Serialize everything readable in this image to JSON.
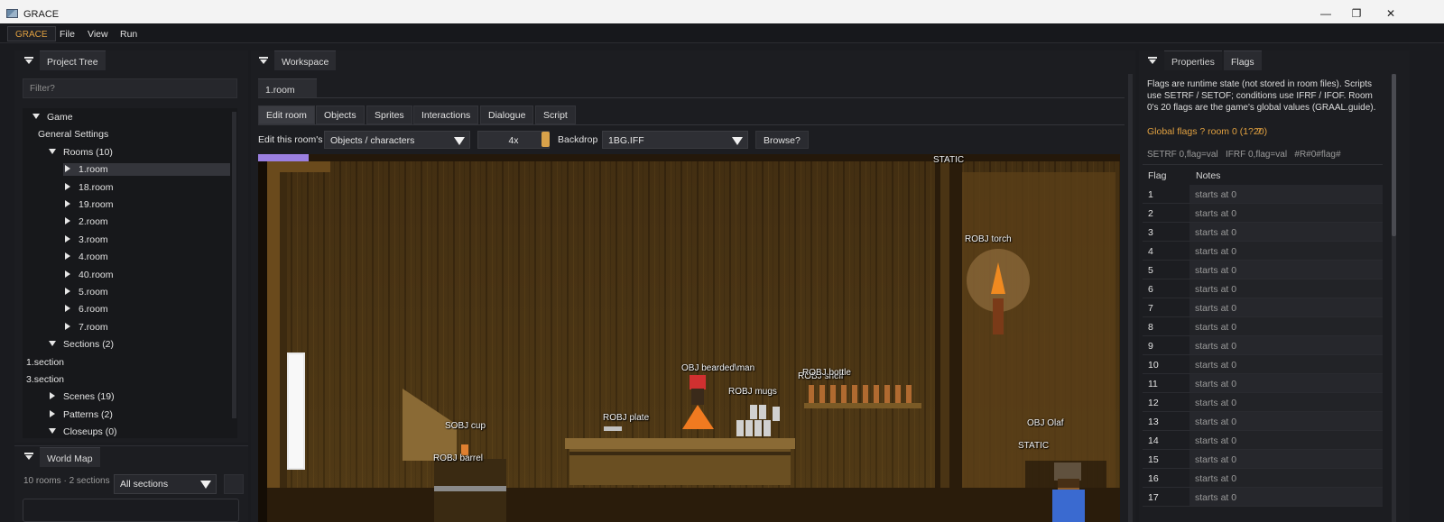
{
  "window": {
    "title": "GRACE",
    "controls": {
      "minimize": "—",
      "maximize": "❐",
      "close": "✕"
    }
  },
  "menubar": {
    "brand": "GRACE",
    "items": [
      "File",
      "View",
      "Run"
    ]
  },
  "left_panel": {
    "tab": "Project Tree",
    "filter_placeholder": "Filter?",
    "tree": [
      {
        "label": "Game",
        "level": 0,
        "state": "expanded"
      },
      {
        "label": "General Settings",
        "level": 1,
        "state": "leaf"
      },
      {
        "label": "Rooms (10)",
        "level": 1,
        "state": "expanded"
      },
      {
        "label": "1.room",
        "level": 2,
        "state": "collapsed",
        "selected": true
      },
      {
        "label": "18.room",
        "level": 2,
        "state": "collapsed"
      },
      {
        "label": "19.room",
        "level": 2,
        "state": "collapsed"
      },
      {
        "label": "2.room",
        "level": 2,
        "state": "collapsed"
      },
      {
        "label": "3.room",
        "level": 2,
        "state": "collapsed"
      },
      {
        "label": "4.room",
        "level": 2,
        "state": "collapsed"
      },
      {
        "label": "40.room",
        "level": 2,
        "state": "collapsed"
      },
      {
        "label": "5.room",
        "level": 2,
        "state": "collapsed"
      },
      {
        "label": "6.room",
        "level": 2,
        "state": "collapsed"
      },
      {
        "label": "7.room",
        "level": 2,
        "state": "collapsed"
      },
      {
        "label": "Sections (2)",
        "level": 1,
        "state": "expanded"
      },
      {
        "label": "1.section",
        "level": 1,
        "state": "leaf"
      },
      {
        "label": "3.section",
        "level": 1,
        "state": "leaf"
      },
      {
        "label": "Scenes (19)",
        "level": 1,
        "state": "collapsed"
      },
      {
        "label": "Patterns (2)",
        "level": 1,
        "state": "collapsed"
      },
      {
        "label": "Closeups (0)",
        "level": 1,
        "state": "expanded"
      }
    ]
  },
  "world_map": {
    "tab": "World Map",
    "summary": "10 rooms · 2 sections",
    "section_select": "All sections"
  },
  "workspace": {
    "tab": "Workspace",
    "doc_tab": "1.room",
    "mode_tabs": [
      "Edit room",
      "Objects",
      "Sprites",
      "Interactions",
      "Dialogue",
      "Script"
    ],
    "active_mode": "Edit room",
    "edit_label": "Edit this room's",
    "edit_select": "Objects / characters",
    "zoom": "4x",
    "backdrop_label": "Backdrop",
    "backdrop_value": "1BG.IFF",
    "browse_label": "Browse?",
    "object_tags": [
      "STATIC",
      "ROBJ torch",
      "OBJ bearded\\man",
      "ROBJ mugs",
      "ROBJ shelf",
      "ROBJ bottle",
      "ROBJ plate",
      "SOBJ cup",
      "ROBJ barrel",
      "OBJ Olaf",
      "STATIC"
    ]
  },
  "right_panel": {
    "tabs": [
      "Properties",
      "Flags"
    ],
    "active_tab": "Flags",
    "description": "Flags are runtime state (not stored in room files). Scripts use SETRF / SETOF; conditions use IFRF / IFOF. Room 0's 20 flags are the game's global values (GRAAL.guide).",
    "global_heading": "Global flags ? room 0 (1?20)",
    "help_mark": "?",
    "syntax": "SETRF 0,flag=val   IFRF 0,flag=val   #R#0#flag#",
    "columns": [
      "Flag",
      "Notes"
    ],
    "rows": [
      {
        "flag": "1",
        "note": "starts at 0"
      },
      {
        "flag": "2",
        "note": "starts at 0"
      },
      {
        "flag": "3",
        "note": "starts at 0"
      },
      {
        "flag": "4",
        "note": "starts at 0"
      },
      {
        "flag": "5",
        "note": "starts at 0"
      },
      {
        "flag": "6",
        "note": "starts at 0"
      },
      {
        "flag": "7",
        "note": "starts at 0"
      },
      {
        "flag": "8",
        "note": "starts at 0"
      },
      {
        "flag": "9",
        "note": "starts at 0"
      },
      {
        "flag": "10",
        "note": "starts at 0"
      },
      {
        "flag": "11",
        "note": "starts at 0"
      },
      {
        "flag": "12",
        "note": "starts at 0"
      },
      {
        "flag": "13",
        "note": "starts at 0"
      },
      {
        "flag": "14",
        "note": "starts at 0"
      },
      {
        "flag": "15",
        "note": "starts at 0"
      },
      {
        "flag": "16",
        "note": "starts at 0"
      },
      {
        "flag": "17",
        "note": "starts at 0"
      }
    ]
  },
  "colors": {
    "accent": "#e0a040",
    "selection": "#9a7fe0",
    "panel": "#1c1d21"
  }
}
